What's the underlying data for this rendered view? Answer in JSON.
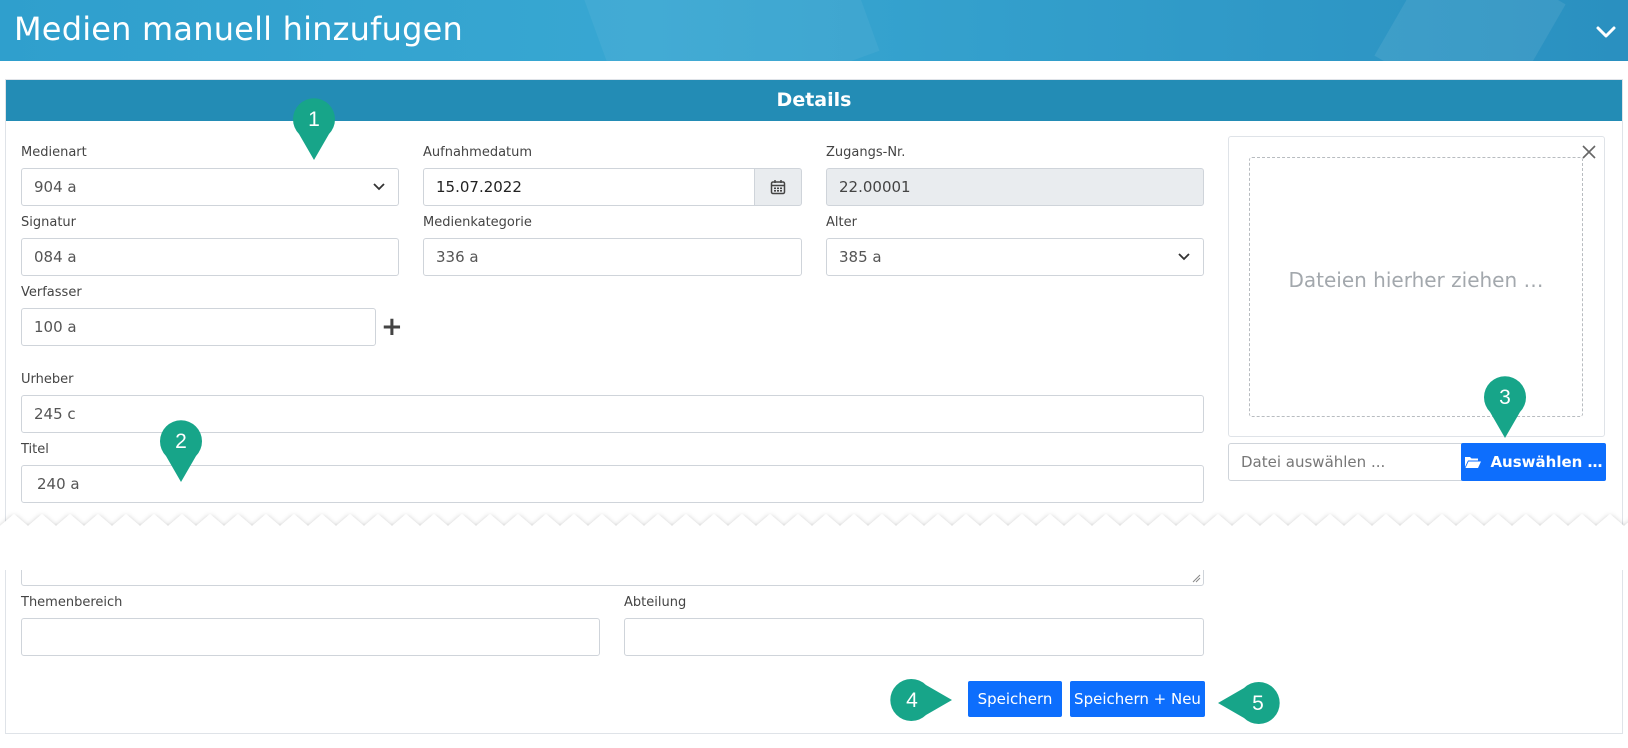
{
  "header": {
    "title": "Medien manuell hinzufugen",
    "collapse_icon": "chevron-down-icon"
  },
  "card": {
    "title": "Details"
  },
  "fields": {
    "medienart": {
      "label": "Medienart",
      "value": "904 a"
    },
    "aufnahmedatum": {
      "label": "Aufnahmedatum",
      "value": "15.07.2022"
    },
    "zugangsnr": {
      "label": "Zugangs-Nr.",
      "value": "22.00001"
    },
    "signatur": {
      "label": "Signatur",
      "value": "084 a"
    },
    "medienkategorie": {
      "label": "Medienkategorie",
      "value": "336 a"
    },
    "alter": {
      "label": "Alter",
      "value": "385 a"
    },
    "verfasser": {
      "label": "Verfasser",
      "value": "100 a",
      "add_label": "+"
    },
    "urheber": {
      "label": "Urheber",
      "value": "245 c"
    },
    "titel": {
      "label": "Titel",
      "value": "240 a"
    },
    "themenbereich": {
      "label": "Themenbereich",
      "value": ""
    },
    "abteilung": {
      "label": "Abteilung",
      "value": ""
    }
  },
  "upload": {
    "dropzone_text": "Dateien hierher ziehen …",
    "file_placeholder": "Datei auswählen ...",
    "browse_label": "Auswählen …"
  },
  "actions": {
    "save_label": "Speichern",
    "save_new_label": "Speichern + Neu"
  },
  "markers": [
    "1",
    "2",
    "3",
    "4",
    "5"
  ],
  "colors": {
    "header_bg": "#2f9fcd",
    "card_header_bg": "#238cb5",
    "primary": "#0d6efd",
    "marker": "#17a589"
  }
}
